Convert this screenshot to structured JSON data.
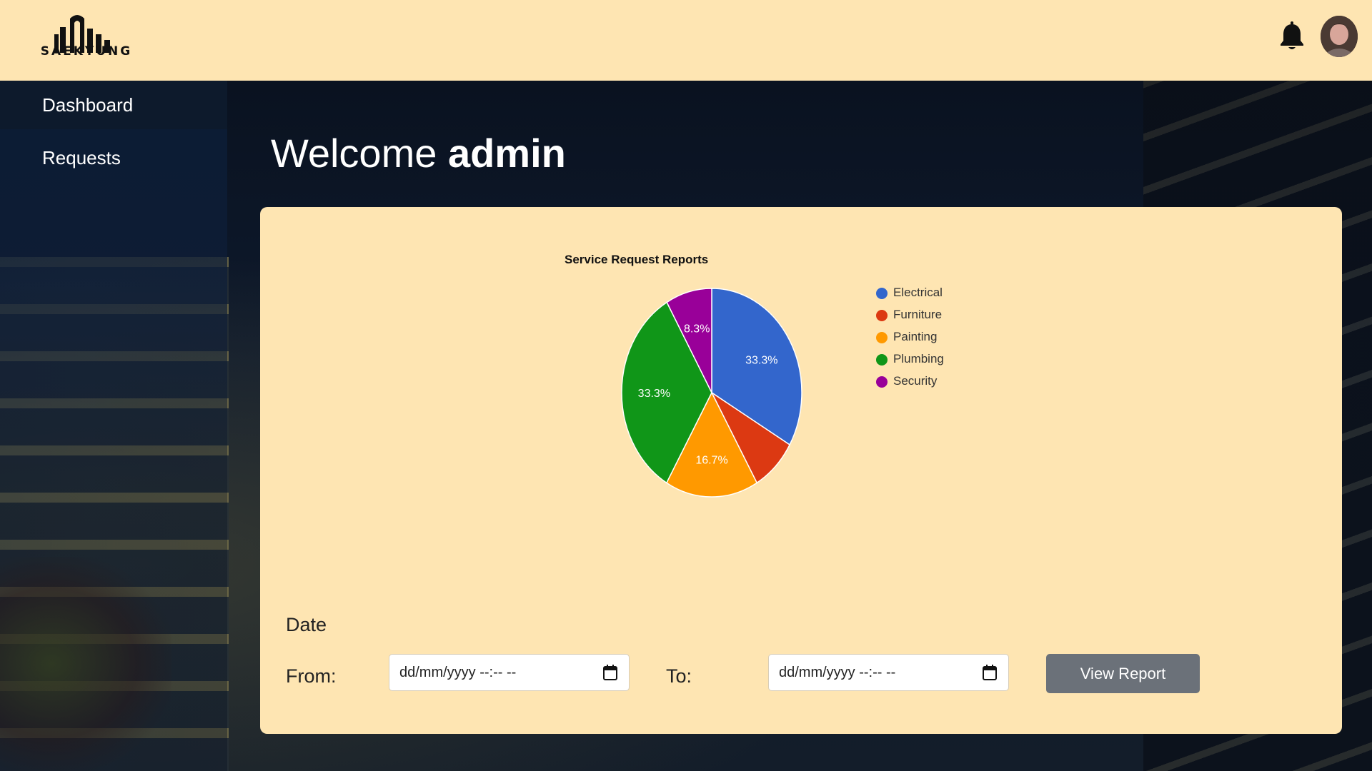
{
  "header": {
    "logo_text": "SAEKYUNG",
    "bell_icon": "bell-icon",
    "avatar_icon": "user-avatar"
  },
  "sidebar": {
    "items": [
      {
        "label": "Dashboard",
        "active": true
      },
      {
        "label": "Requests",
        "active": false
      }
    ]
  },
  "welcome": {
    "greeting": "Welcome",
    "user": "admin"
  },
  "chart_data": {
    "type": "pie",
    "title": "Service Request Reports",
    "categories": [
      "Electrical",
      "Furniture",
      "Painting",
      "Plumbing",
      "Security"
    ],
    "values": [
      33.3,
      8.3,
      16.7,
      33.3,
      8.3
    ],
    "labels": [
      "33.3%",
      "",
      "16.7%",
      "33.3%",
      "8.3%"
    ],
    "colors": [
      "#3366cc",
      "#dc3912",
      "#ff9900",
      "#109618",
      "#990099"
    ],
    "legend_position": "right"
  },
  "filter": {
    "date_label": "Date",
    "from_label": "From:",
    "to_label": "To:",
    "from_value": "dd/mm/yyyy --:-- --",
    "to_value": "dd/mm/yyyy --:-- --",
    "calendar_icon": "calendar-icon",
    "button_label": "View Report"
  }
}
